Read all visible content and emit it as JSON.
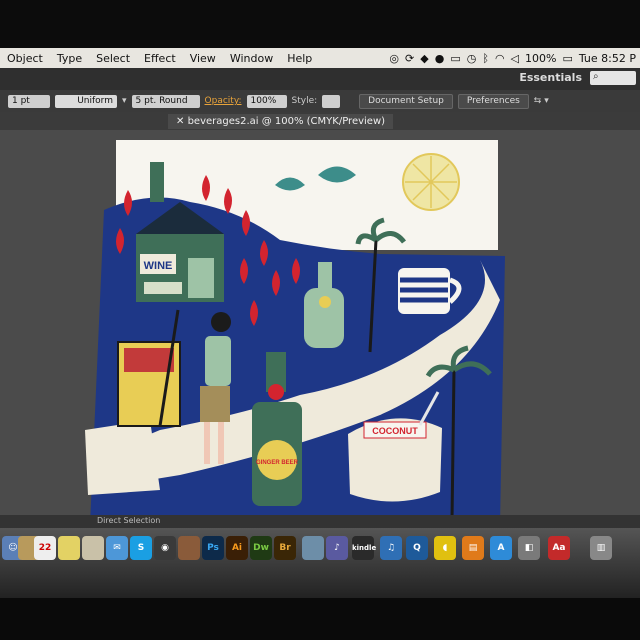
{
  "menubar": {
    "items": [
      "Object",
      "Type",
      "Select",
      "Effect",
      "View",
      "Window",
      "Help"
    ],
    "battery": "100%",
    "clock": "Tue 8:52 P"
  },
  "app_header": {
    "workspace": "Essentials",
    "search_icon": "search-icon"
  },
  "control_bar": {
    "stroke_weight": "1 pt",
    "stroke_profile": "Uniform",
    "brush": "5 pt. Round",
    "opacity_label": "Opacity:",
    "opacity_value": "100%",
    "style_label": "Style:",
    "doc_setup_button": "Document Setup",
    "preferences_button": "Preferences"
  },
  "document_tab": {
    "title": "beverages2.ai @ 100% (CMYK/Preview)"
  },
  "artwork": {
    "wine_label": "WINE",
    "coconut_label": "COCONUT",
    "ginger_beer_label": "GINGER BEER",
    "colors": {
      "navy": "#1e3787",
      "cream": "#efeadb",
      "green": "#3f6f58",
      "red": "#d3242f",
      "yellow": "#e8cd55"
    }
  },
  "status_bar": {
    "tool": "Direct Selection"
  },
  "dock": {
    "date_day": "22",
    "apps": [
      "Ps",
      "Ai",
      "Dw",
      "Br",
      "Aa"
    ],
    "kindle": "kindle"
  }
}
